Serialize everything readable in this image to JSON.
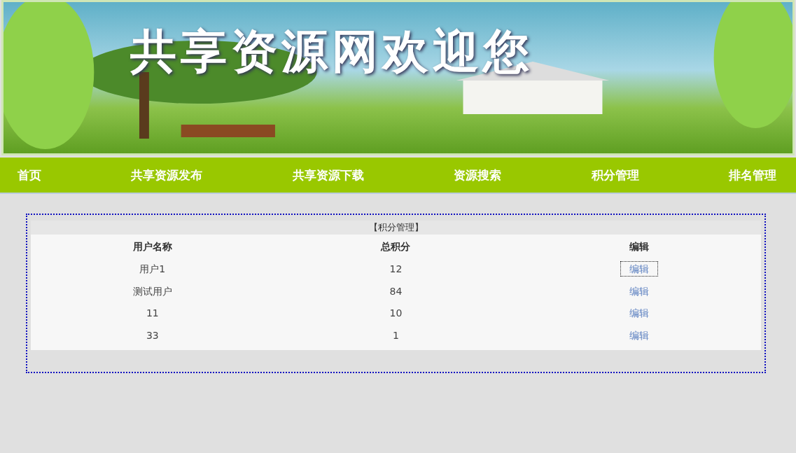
{
  "banner": {
    "title": "共享资源网欢迎您"
  },
  "nav": [
    {
      "label": "首页"
    },
    {
      "label": "共享资源发布"
    },
    {
      "label": "共享资源下载"
    },
    {
      "label": "资源搜索"
    },
    {
      "label": "积分管理"
    },
    {
      "label": "排名管理"
    }
  ],
  "panel": {
    "title": "【积分管理】",
    "columns": [
      "用户名称",
      "总积分",
      "编辑"
    ],
    "rows": [
      {
        "name": "用户1",
        "score": "12",
        "action": "编辑",
        "focused": true
      },
      {
        "name": "测试用户",
        "score": "84",
        "action": "编辑",
        "focused": false
      },
      {
        "name": "11",
        "score": "10",
        "action": "编辑",
        "focused": false
      },
      {
        "name": "33",
        "score": "1",
        "action": "编辑",
        "focused": false
      }
    ]
  }
}
